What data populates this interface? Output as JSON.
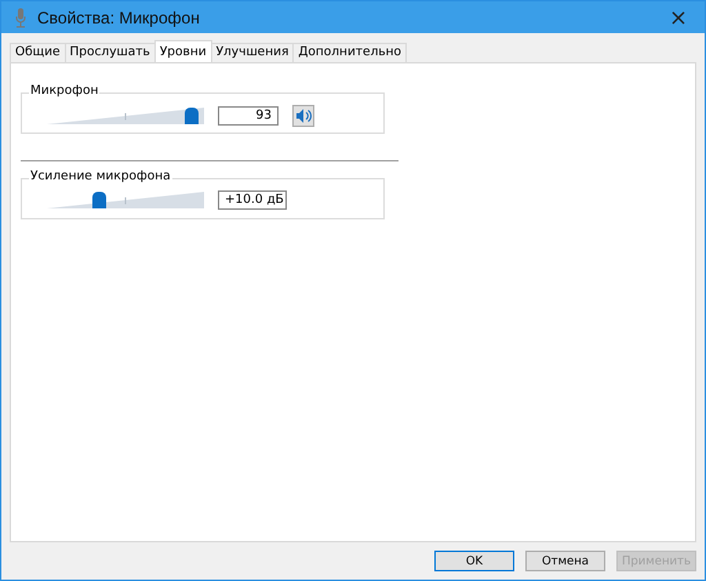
{
  "window": {
    "title": "Свойства: Микрофон",
    "close": "×"
  },
  "tabs": [
    {
      "label": "Общие",
      "selected": false
    },
    {
      "label": "Прослушать",
      "selected": false
    },
    {
      "label": "Уровни",
      "selected": true
    },
    {
      "label": "Улучшения",
      "selected": false
    },
    {
      "label": "Дополнительно",
      "selected": false
    }
  ],
  "levels": [
    {
      "name": "Микрофон",
      "level": 0.92,
      "value": "93",
      "kind": "volume",
      "muted": false
    },
    {
      "name": "Усиление микрофона",
      "level": 0.33,
      "value": "+10.0 дБ",
      "kind": "boost"
    }
  ],
  "buttons": [
    {
      "label": "OK",
      "disabled": false,
      "default": true
    },
    {
      "label": "Отмена",
      "disabled": false,
      "default": false
    },
    {
      "label": "Применить",
      "disabled": true,
      "default": false
    }
  ]
}
